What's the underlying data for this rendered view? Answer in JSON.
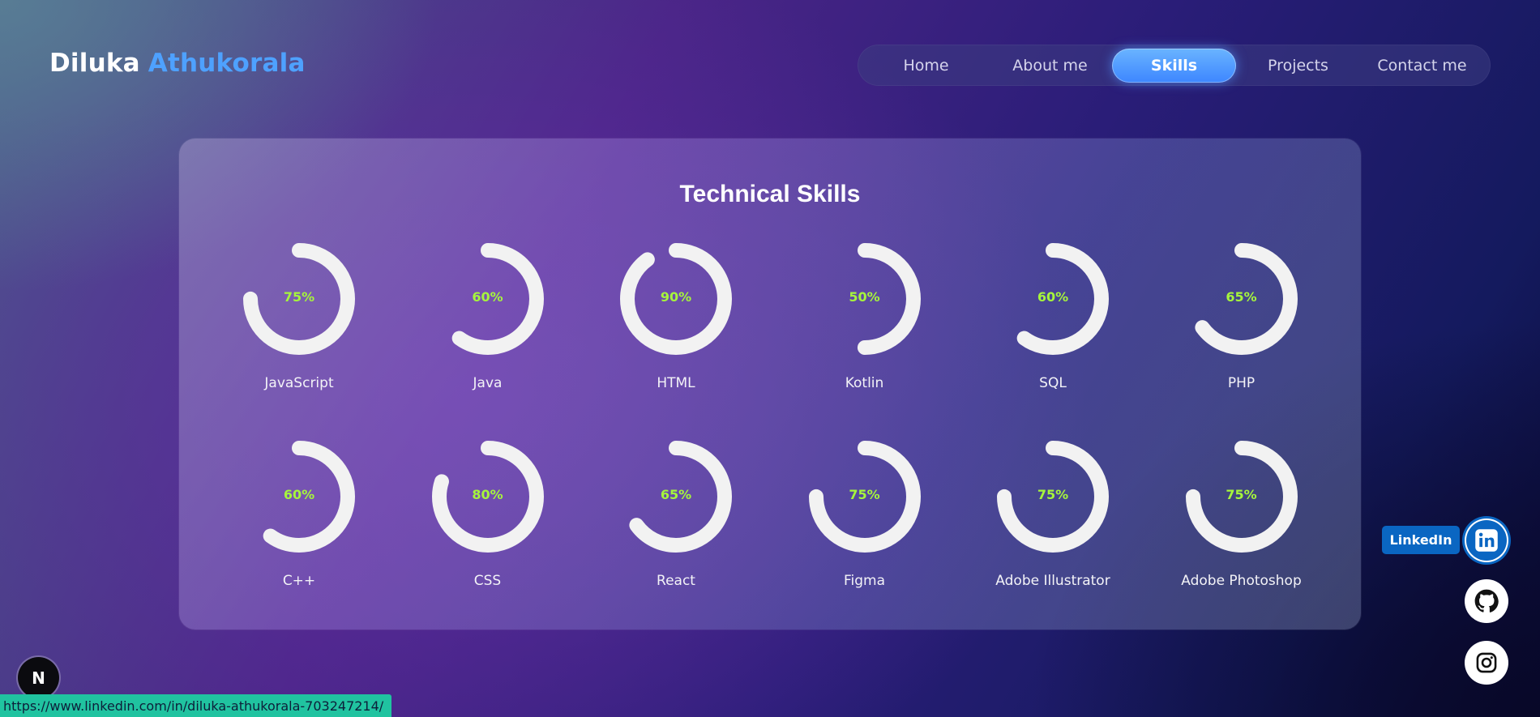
{
  "brand": {
    "first": "Diluka",
    "last": "Athukorala"
  },
  "nav": {
    "items": [
      {
        "label": "Home",
        "active": false
      },
      {
        "label": "About me",
        "active": false
      },
      {
        "label": "Skills",
        "active": true
      },
      {
        "label": "Projects",
        "active": false
      },
      {
        "label": "Contact me",
        "active": false
      }
    ]
  },
  "skills": {
    "title": "Technical Skills",
    "items": [
      {
        "name": "JavaScript",
        "percent": 75,
        "label": "75%"
      },
      {
        "name": "Java",
        "percent": 60,
        "label": "60%"
      },
      {
        "name": "HTML",
        "percent": 90,
        "label": "90%"
      },
      {
        "name": "Kotlin",
        "percent": 50,
        "label": "50%"
      },
      {
        "name": "SQL",
        "percent": 60,
        "label": "60%"
      },
      {
        "name": "PHP",
        "percent": 65,
        "label": "65%"
      },
      {
        "name": "C++",
        "percent": 60,
        "label": "60%"
      },
      {
        "name": "CSS",
        "percent": 80,
        "label": "80%"
      },
      {
        "name": "React",
        "percent": 65,
        "label": "65%"
      },
      {
        "name": "Figma",
        "percent": 75,
        "label": "75%"
      },
      {
        "name": "Adobe Illustrator",
        "percent": 75,
        "label": "75%"
      },
      {
        "name": "Adobe Photoshop",
        "percent": 75,
        "label": "75%"
      }
    ]
  },
  "social": {
    "linkedin_label": "LinkedIn",
    "icons": [
      "linkedin-icon",
      "github-icon",
      "instagram-icon"
    ]
  },
  "badge": {
    "letter": "N"
  },
  "status_bar": {
    "url": "https://www.linkedin.com/in/diluka-athukorala-703247214/"
  },
  "colors": {
    "accent_blue": "#4ea1ff",
    "percent_green": "#a6f53c",
    "ring": "#f2f2f2",
    "linkedin": "#0a66c2",
    "status_bar": "#20c3a0"
  }
}
